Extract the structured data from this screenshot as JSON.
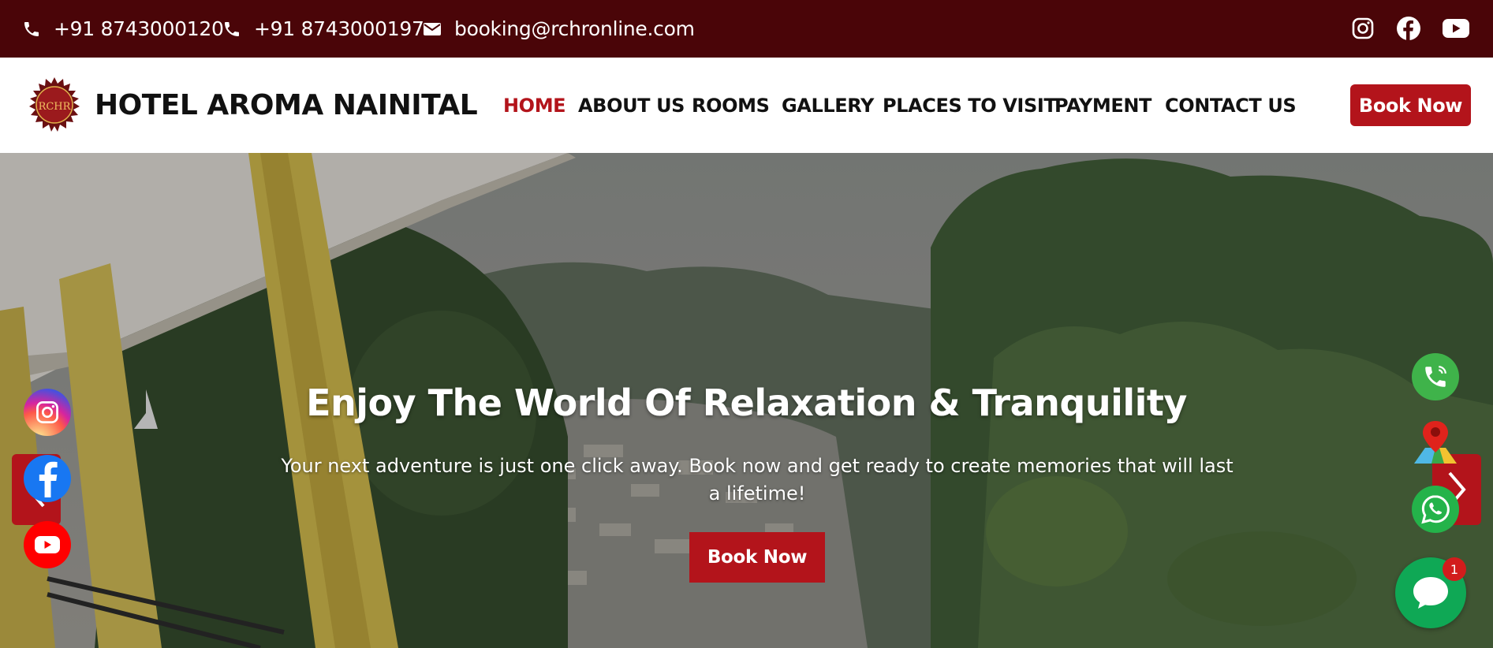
{
  "topbar": {
    "phone1": "+91 8743000120",
    "phone2": "+91 8743000197",
    "email": "booking@rchronline.com",
    "phone_icon": "phone-icon",
    "email_icon": "envelope-icon",
    "social_icons": [
      "instagram-icon",
      "facebook-icon",
      "youtube-icon"
    ]
  },
  "header": {
    "logo_text": "RCHR",
    "brand": "HOTEL AROMA NAINITAL",
    "nav": [
      "HOME",
      "ABOUT US",
      "ROOMS",
      "GALLERY",
      "PLACES TO VISIT",
      "PAYMENT",
      "CONTACT US"
    ],
    "active_nav": "HOME",
    "book_button": "Book Now"
  },
  "hero": {
    "title": "Enjoy The World Of Relaxation & Tranquility",
    "subtitle": "Your next adventure is just one click away. Book now and get ready to create memories that will last a lifetime!",
    "button": "Book Now"
  },
  "floating": {
    "left": [
      "instagram-icon",
      "facebook-icon",
      "youtube-icon"
    ],
    "right": [
      "phone-call-icon",
      "map-pin-icon",
      "whatsapp-icon"
    ],
    "chat_badge": "1"
  },
  "colors": {
    "topbar_bg": "#4a0508",
    "accent": "#b3141b",
    "chat_green": "#0fa855"
  }
}
